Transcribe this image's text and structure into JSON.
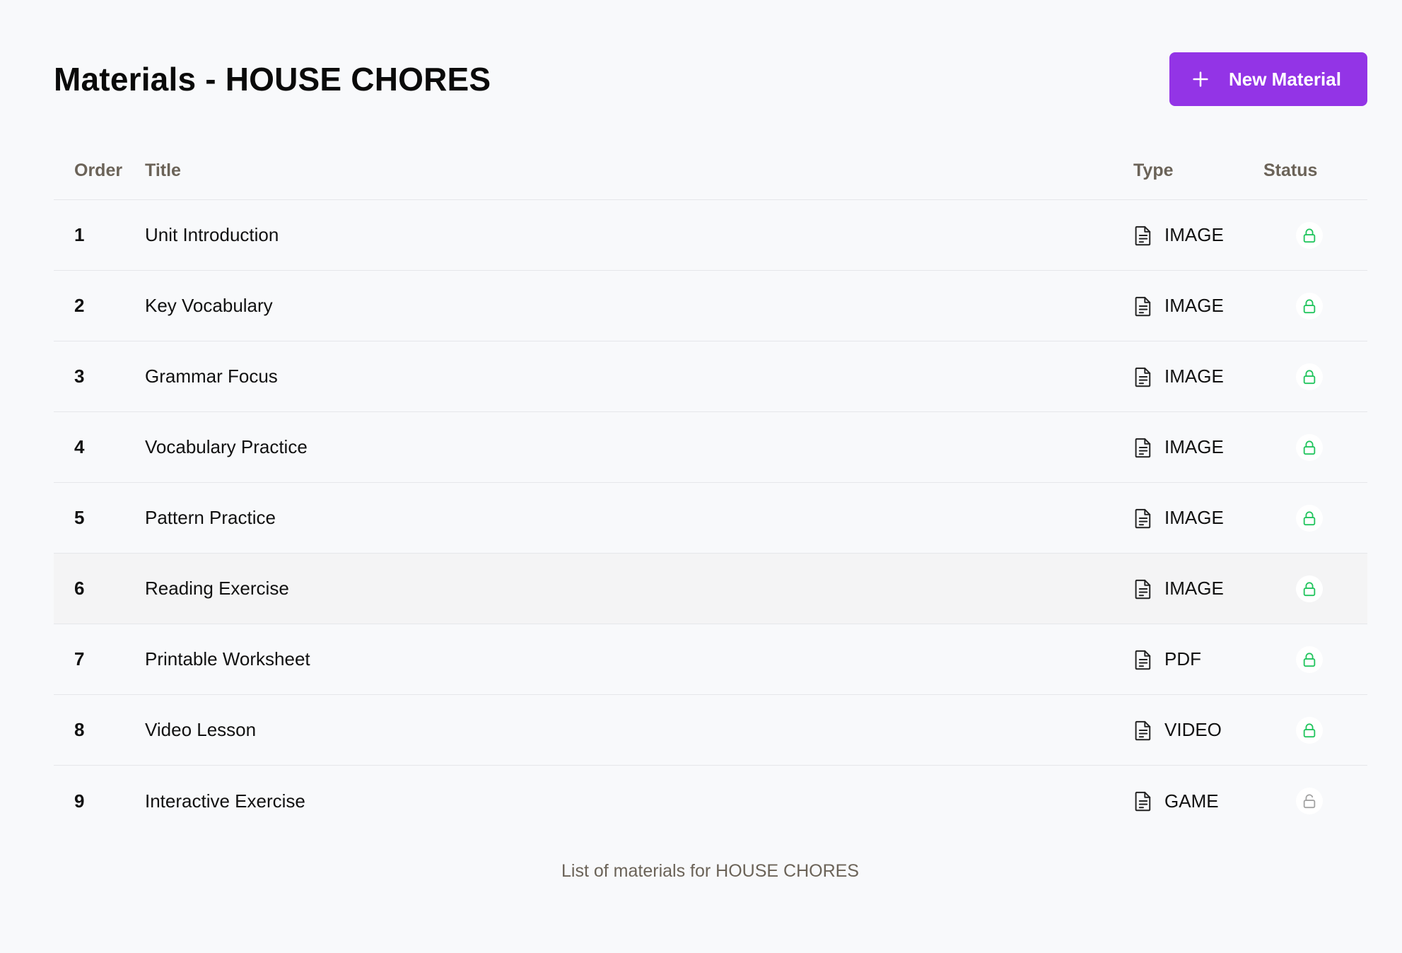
{
  "header": {
    "title": "Materials - HOUSE CHORES",
    "new_button_label": "New Material"
  },
  "table": {
    "columns": {
      "order": "Order",
      "title": "Title",
      "type": "Type",
      "status": "Status"
    },
    "rows": [
      {
        "order": "1",
        "title": "Unit Introduction",
        "type": "IMAGE",
        "status": "locked"
      },
      {
        "order": "2",
        "title": "Key Vocabulary",
        "type": "IMAGE",
        "status": "locked"
      },
      {
        "order": "3",
        "title": "Grammar Focus",
        "type": "IMAGE",
        "status": "locked"
      },
      {
        "order": "4",
        "title": "Vocabulary Practice",
        "type": "IMAGE",
        "status": "locked"
      },
      {
        "order": "5",
        "title": "Pattern Practice",
        "type": "IMAGE",
        "status": "locked"
      },
      {
        "order": "6",
        "title": "Reading Exercise",
        "type": "IMAGE",
        "status": "locked"
      },
      {
        "order": "7",
        "title": "Printable Worksheet",
        "type": "PDF",
        "status": "locked"
      },
      {
        "order": "8",
        "title": "Video Lesson",
        "type": "VIDEO",
        "status": "locked"
      },
      {
        "order": "9",
        "title": "Interactive Exercise",
        "type": "GAME",
        "status": "unlocked"
      }
    ],
    "caption": "List of materials for HOUSE CHORES"
  },
  "icons": {
    "add": "plus-icon",
    "type": "file-text-icon",
    "status_locked": "lock-icon",
    "status_unlocked": "unlock-icon"
  },
  "colors": {
    "accent": "#9334e6",
    "locked": "#22c55e",
    "unlocked": "#a3a3a3",
    "muted_text": "#6b6358"
  }
}
